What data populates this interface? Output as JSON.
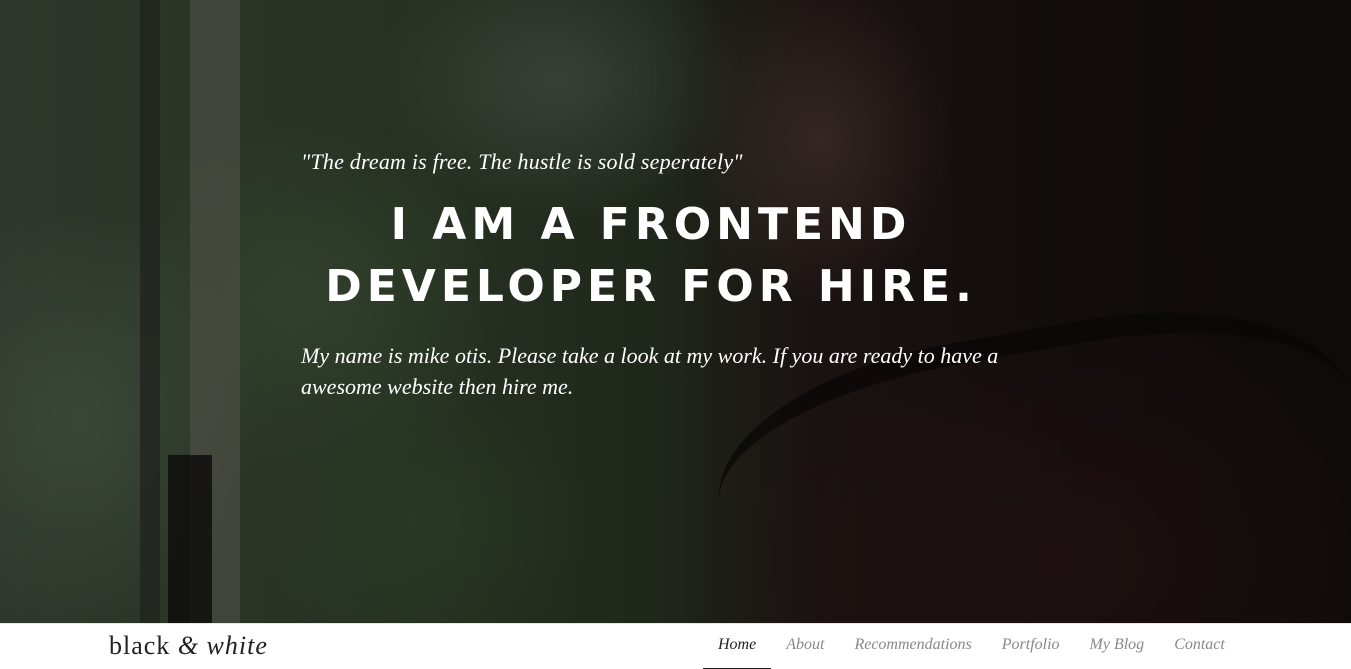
{
  "hero": {
    "quote": "\"The dream is free. The hustle is sold seperately\"",
    "headline_line1": "I AM A FRONTEND",
    "headline_line2": "DEVELOPER FOR HIRE.",
    "intro": "My name is mike otis. Please take a look at my work. If you are ready to have a awesome website then hire me."
  },
  "navbar": {
    "brand": {
      "part1": "black",
      "amp": "&",
      "part2": "white"
    },
    "items": [
      {
        "label": "Home",
        "active": true
      },
      {
        "label": "About",
        "active": false
      },
      {
        "label": "Recommendations",
        "active": false
      },
      {
        "label": "Portfolio",
        "active": false
      },
      {
        "label": "My Blog",
        "active": false
      },
      {
        "label": "Contact",
        "active": false
      }
    ]
  },
  "colors": {
    "overlay": "#000000",
    "text_light": "#ffffff",
    "nav_active": "#222222",
    "nav_inactive": "#888888",
    "navbar_bg": "#ffffff"
  }
}
